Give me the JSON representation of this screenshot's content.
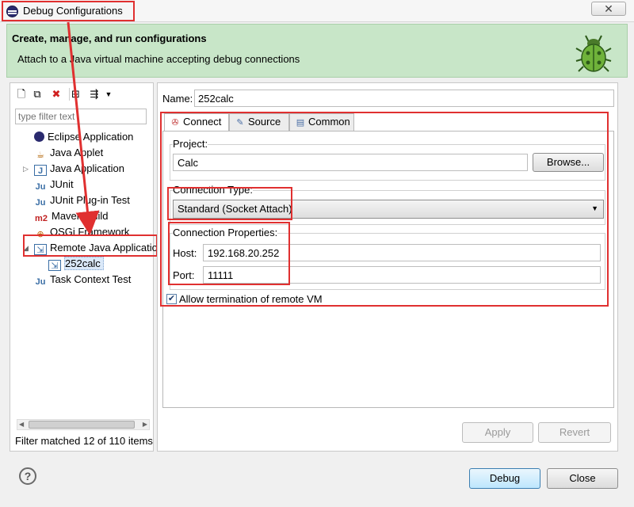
{
  "window": {
    "title": "Debug Configurations",
    "close_glyph": "✕"
  },
  "header": {
    "title": "Create, manage, and run configurations",
    "subtitle": "Attach to a Java virtual machine accepting debug connections"
  },
  "left_panel": {
    "filter_placeholder": "type filter text",
    "tree": [
      {
        "label": "Eclipse Application",
        "icon": "eclipse-icon"
      },
      {
        "label": "Java Applet",
        "icon": "java-applet-icon"
      },
      {
        "label": "Java Application",
        "icon": "java-application-icon"
      },
      {
        "label": "JUnit",
        "icon": "junit-icon"
      },
      {
        "label": "JUnit Plug-in Test",
        "icon": "junit-plugin-icon"
      },
      {
        "label": "Maven Build",
        "icon": "maven-icon",
        "icon_text": "m2"
      },
      {
        "label": "OSGi Framework",
        "icon": "osgi-icon"
      },
      {
        "label": "Remote Java Application",
        "icon": "remote-java-icon"
      },
      {
        "label": "252calc",
        "icon": "remote-launch-icon"
      },
      {
        "label": "Task Context Test",
        "icon": "task-context-icon"
      }
    ],
    "status": "Filter matched 12 of 110 items"
  },
  "right_panel": {
    "name_label": "Name:",
    "name_value": "252calc",
    "tabs": [
      {
        "label": "Connect",
        "icon": "connect-icon"
      },
      {
        "label": "Source",
        "icon": "source-icon"
      },
      {
        "label": "Common",
        "icon": "common-icon"
      }
    ],
    "project": {
      "label": "Project:",
      "value": "Calc",
      "browse_label": "Browse..."
    },
    "connection_type": {
      "label": "Connection Type:",
      "value": "Standard (Socket Attach)"
    },
    "connection_properties": {
      "label": "Connection Properties:",
      "host_label": "Host:",
      "host_value": "192.168.20.252",
      "port_label": "Port:",
      "port_value": "11111"
    },
    "allow_termination": {
      "label": "Allow termination of remote VM",
      "checked": true
    },
    "apply_label": "Apply",
    "revert_label": "Revert"
  },
  "footer": {
    "help_glyph": "?",
    "debug_label": "Debug",
    "close_label": "Close"
  },
  "colors": {
    "header_bg": "#c8e6c8",
    "highlight": "#e03030",
    "selection": "#dbe9f9"
  }
}
